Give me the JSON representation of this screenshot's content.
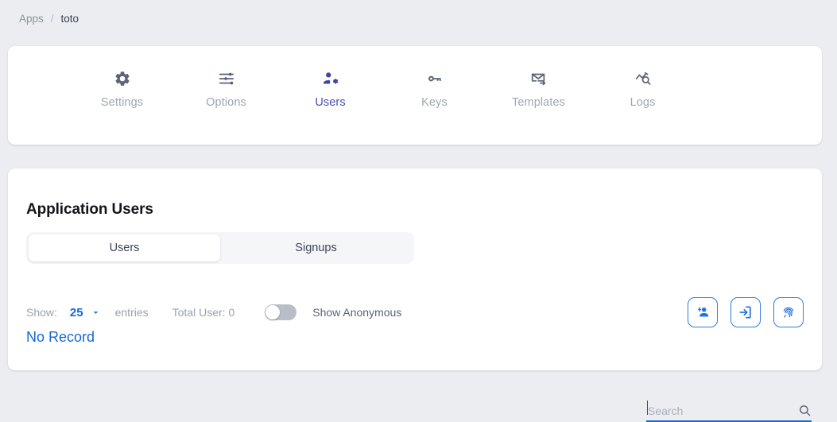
{
  "breadcrumb": {
    "root": "Apps",
    "separator": "/",
    "current": "toto"
  },
  "tabs": [
    {
      "label": "Settings",
      "icon": "gear-icon",
      "active": false
    },
    {
      "label": "Options",
      "icon": "tune-sliders-icon",
      "active": false
    },
    {
      "label": "Users",
      "icon": "manage-accounts-icon",
      "active": true
    },
    {
      "label": "Keys",
      "icon": "key-icon",
      "active": false
    },
    {
      "label": "Templates",
      "icon": "email-send-icon",
      "active": false
    },
    {
      "label": "Logs",
      "icon": "query-stats-icon",
      "active": false
    }
  ],
  "users_panel": {
    "title": "Application Users",
    "segments": [
      {
        "label": "Users",
        "active": true
      },
      {
        "label": "Signups",
        "active": false
      }
    ],
    "search": {
      "placeholder": "Search",
      "value": "",
      "icon": "search-icon"
    },
    "controls": {
      "show_label": "Show:",
      "entries_value": "25",
      "entries_label": "entries",
      "total_user": "Total User: 0",
      "anonymous_toggle_label": "Show Anonymous",
      "anonymous_toggle_on": false
    },
    "actions": [
      {
        "name": "add-user-button",
        "icon": "person-add-icon"
      },
      {
        "name": "import-users-button",
        "icon": "login-arrow-icon"
      },
      {
        "name": "biometrics-button",
        "icon": "fingerprint-icon"
      }
    ],
    "empty_state": "No Record"
  },
  "colors": {
    "page_background": "#ebedf0",
    "card_background": "#ffffff",
    "accent_blue": "#1767d6",
    "active_tab": "#4a4fae",
    "inactive_icon": "#5c6478",
    "inactive_label": "#a0a5b2",
    "action_border": "#2f7ae5"
  }
}
